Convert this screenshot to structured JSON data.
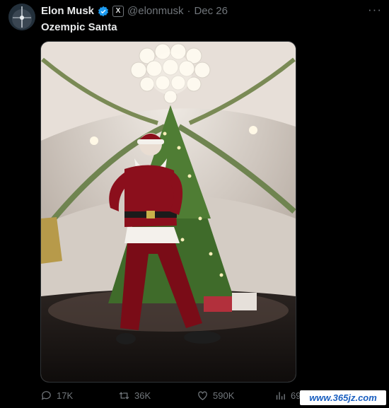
{
  "tweet": {
    "author_name": "Elon Musk",
    "affiliate_badge": "X",
    "handle": "@elonmusk",
    "separator": "·",
    "date": "Dec 26",
    "text": "Ozempic Santa",
    "more_label": "···"
  },
  "icons": {
    "avatar": "avatar",
    "verified": "verified-badge-icon",
    "reply": "reply-icon",
    "retweet": "retweet-icon",
    "like": "like-icon",
    "views": "views-icon"
  },
  "metrics": {
    "replies": "17K",
    "retweets": "36K",
    "likes": "590K",
    "views": "69"
  },
  "watermark": "www.365jz.com",
  "colors": {
    "background": "#000000",
    "text_primary": "#e7e9ea",
    "text_secondary": "#71767b",
    "verified_blue": "#1d9bf0",
    "santa_red": "#8b0f1c",
    "tree_green": "#3f6b2a"
  }
}
